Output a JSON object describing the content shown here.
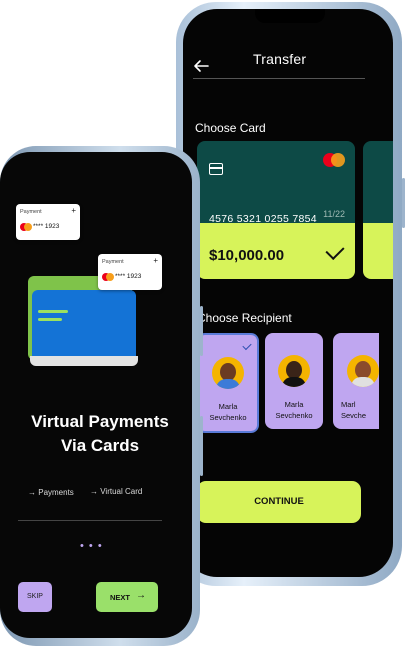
{
  "transfer_screen": {
    "title": "Transfer",
    "section_card": "Choose Card",
    "card": {
      "number": "4576 5321 0255 7854",
      "expiry": "11/22",
      "balance": "$10,000.00"
    },
    "section_recipient": "Choose Recipient",
    "recipients": [
      {
        "name_line1": "Marla",
        "name_line2": "Sevchenko",
        "selected": true
      },
      {
        "name_line1": "Marla",
        "name_line2": "Sevchenko",
        "selected": false
      },
      {
        "name_line1": "Marl",
        "name_line2": "Sevche",
        "selected": false
      }
    ],
    "continue_label": "CONTINUE"
  },
  "onboarding_screen": {
    "mini_cards": [
      {
        "label": "Payment",
        "number": "**** 1923"
      },
      {
        "label": "Payment",
        "number": "**** 1923"
      }
    ],
    "headline_line1": "Virtual Payments",
    "headline_line2": "Via Cards",
    "link_payments": "Payments",
    "link_virtual_card": "Virtual Card",
    "pager_dots": "• • •",
    "skip_label": "SKIP",
    "next_label": "NEXT"
  },
  "colors": {
    "lime": "#d7f35a",
    "lavender": "#bfa6f0",
    "card_green": "#0d4a46",
    "next_green": "#9ae06a"
  }
}
